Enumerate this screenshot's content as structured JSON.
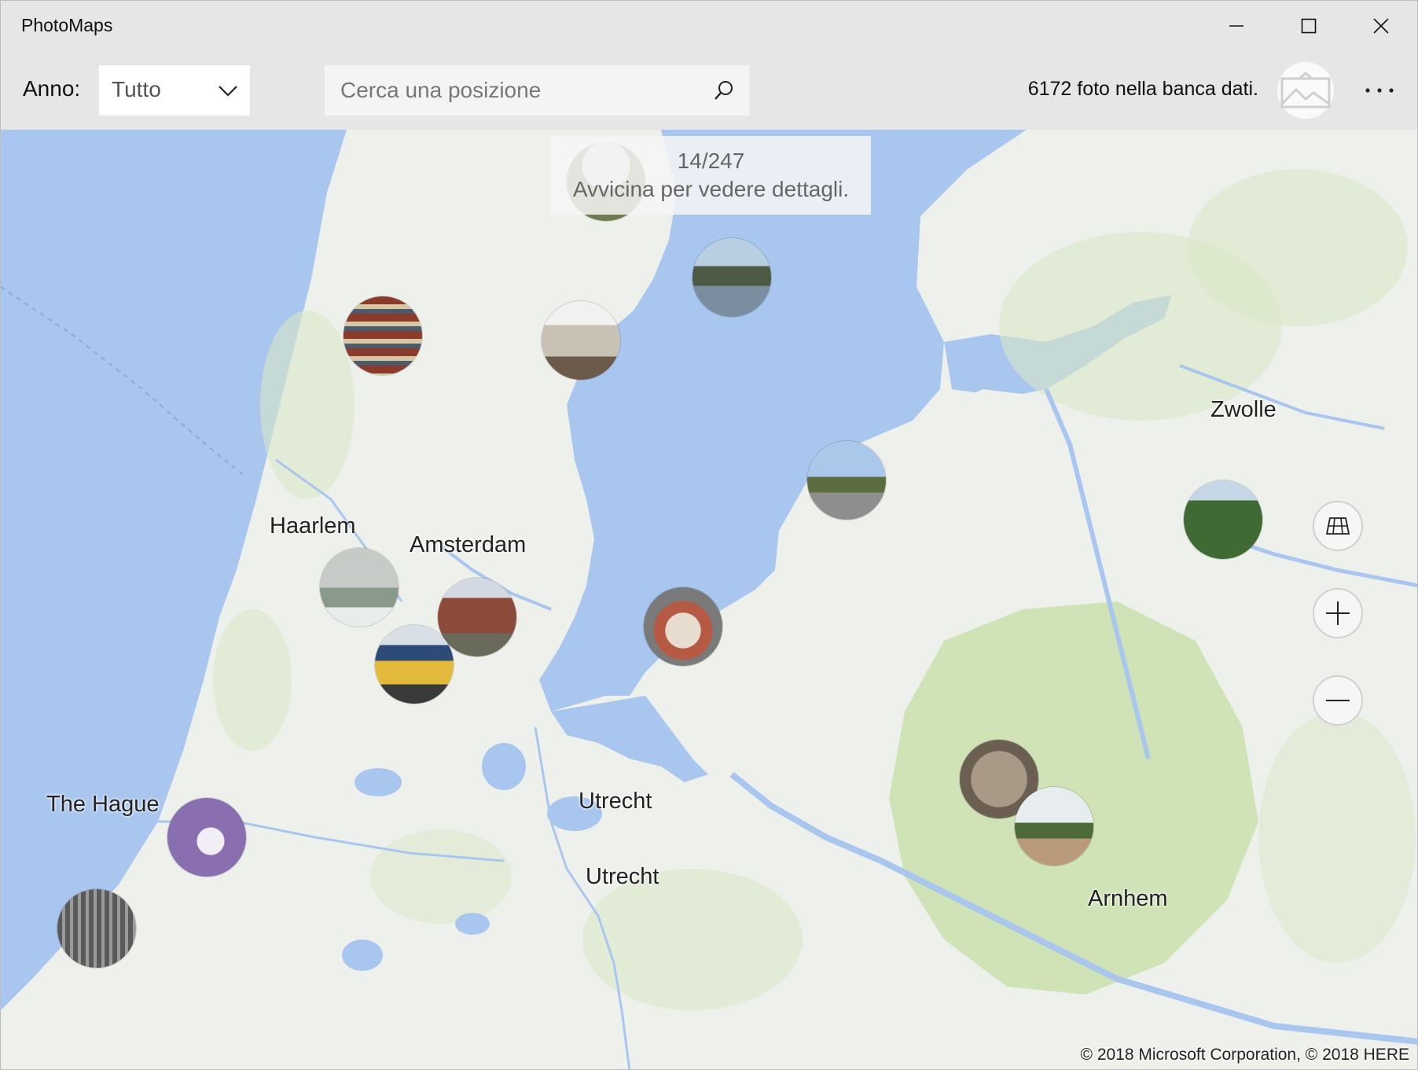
{
  "window": {
    "title": "PhotoMaps",
    "minimize_icon": "minimize-icon",
    "maximize_icon": "maximize-icon",
    "close_icon": "close-icon"
  },
  "toolbar": {
    "year_label": "Anno:",
    "year_value": "Tutto",
    "search_placeholder": "Cerca una posizione",
    "photo_count": "6172 foto nella banca dati.",
    "avatar_icon": "image-icon",
    "more_icon": "more-icon"
  },
  "map": {
    "notice_count": "14/247",
    "notice_text": "Avvicina per vedere dettagli.",
    "cities": {
      "haarlem": "Haarlem",
      "amsterdam": "Amsterdam",
      "zwolle": "Zwolle",
      "utrecht_1": "Utrecht",
      "utrecht_2": "Utrecht",
      "arnhem": "Arnhem",
      "den_haag": "The Hague"
    },
    "photo_pins": [
      {
        "name": "photo-pin-north"
      },
      {
        "name": "photo-pin-canal"
      },
      {
        "name": "photo-pin-shelves"
      },
      {
        "name": "photo-pin-building"
      },
      {
        "name": "photo-pin-square"
      },
      {
        "name": "photo-pin-zwolle-field"
      },
      {
        "name": "photo-pin-aerial"
      },
      {
        "name": "photo-pin-station"
      },
      {
        "name": "photo-pin-train"
      },
      {
        "name": "photo-pin-food"
      },
      {
        "name": "photo-pin-sculpture"
      },
      {
        "name": "photo-pin-heath"
      },
      {
        "name": "photo-pin-poster"
      },
      {
        "name": "photo-pin-hall"
      }
    ],
    "controls": {
      "style_icon": "grid-map-icon",
      "zoom_in_icon": "plus-icon",
      "zoom_out_icon": "minus-icon"
    },
    "copyright": "© 2018 Microsoft Corporation, © 2018 HERE"
  }
}
